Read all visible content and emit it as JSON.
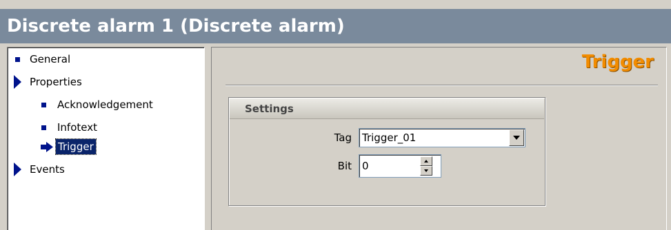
{
  "window": {
    "title": "Discrete alarm 1 (Discrete alarm)"
  },
  "tree": {
    "items": [
      {
        "label": "General",
        "icon": "square-bullet-icon"
      },
      {
        "label": "Properties",
        "icon": "expanded-triangle-icon"
      },
      {
        "label": "Acknowledgement",
        "icon": "square-bullet-icon"
      },
      {
        "label": "Infotext",
        "icon": "square-bullet-icon"
      },
      {
        "label": "Trigger",
        "icon": "selected-arrow-icon",
        "selected": true
      },
      {
        "label": "Events",
        "icon": "expanded-triangle-icon"
      }
    ]
  },
  "page": {
    "heading": "Trigger",
    "settings": {
      "title": "Settings",
      "tag_label": "Tag",
      "tag_value": "Trigger_01",
      "bit_label": "Bit",
      "bit_value": "0"
    }
  },
  "colors": {
    "title_bar": "#7a8a9c",
    "heading": "#f28c00",
    "tree_icon": "#00138c",
    "selection": "#0a246a"
  }
}
